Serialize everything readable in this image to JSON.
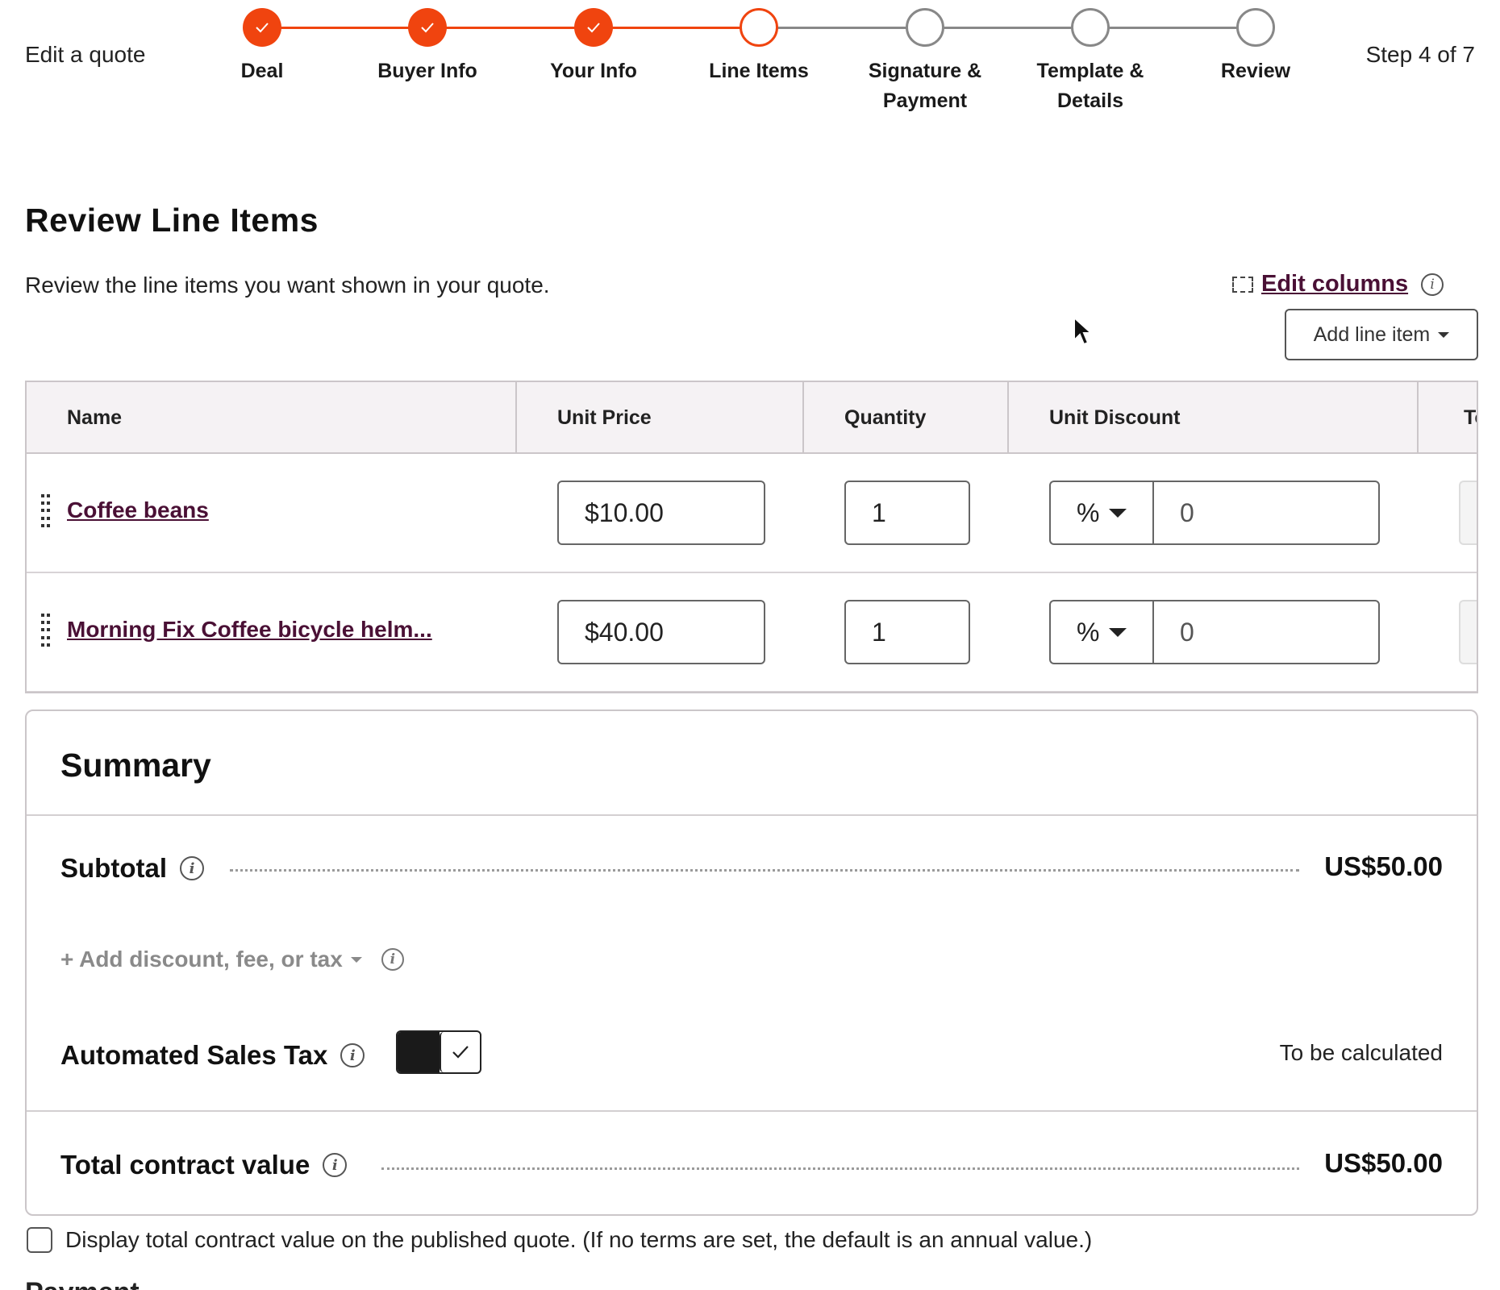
{
  "header": {
    "title": "Edit a quote",
    "step_count": "Step 4 of 7"
  },
  "stepper": {
    "accent_color": "#f0440f",
    "steps": [
      {
        "label": "Deal",
        "state": "done"
      },
      {
        "label": "Buyer Info",
        "state": "done"
      },
      {
        "label": "Your Info",
        "state": "done"
      },
      {
        "label": "Line Items",
        "state": "current"
      },
      {
        "label": "Signature & Payment",
        "state": "todo"
      },
      {
        "label": "Template & Details",
        "state": "todo"
      },
      {
        "label": "Review",
        "state": "todo"
      }
    ]
  },
  "section": {
    "title": "Review Line Items",
    "description": "Review the line items you want shown in your quote.",
    "edit_columns_label": "Edit columns",
    "add_line_item_label": "Add line item"
  },
  "table": {
    "columns": [
      "Name",
      "Unit Price",
      "Quantity",
      "Unit Discount",
      "To"
    ],
    "rows": [
      {
        "name": "Coffee beans",
        "unit_price": "$10.00",
        "quantity": "1",
        "discount_type": "%",
        "discount_value": "0"
      },
      {
        "name": "Morning Fix Coffee bicycle helm...",
        "unit_price": "$40.00",
        "quantity": "1",
        "discount_type": "%",
        "discount_value": "0"
      }
    ]
  },
  "summary": {
    "title": "Summary",
    "subtotal_label": "Subtotal",
    "subtotal_value": "US$50.00",
    "add_discount_label": "+ Add discount, fee, or tax",
    "sales_tax_label": "Automated Sales Tax",
    "sales_tax_enabled": true,
    "sales_tax_value": "To be calculated",
    "total_label": "Total contract value",
    "total_value": "US$50.00"
  },
  "display_total": {
    "checked": false,
    "label": "Display total contract value on the published quote. (If no terms are set, the default is an annual value.)"
  },
  "next_section_heading": "Payment Schedule"
}
